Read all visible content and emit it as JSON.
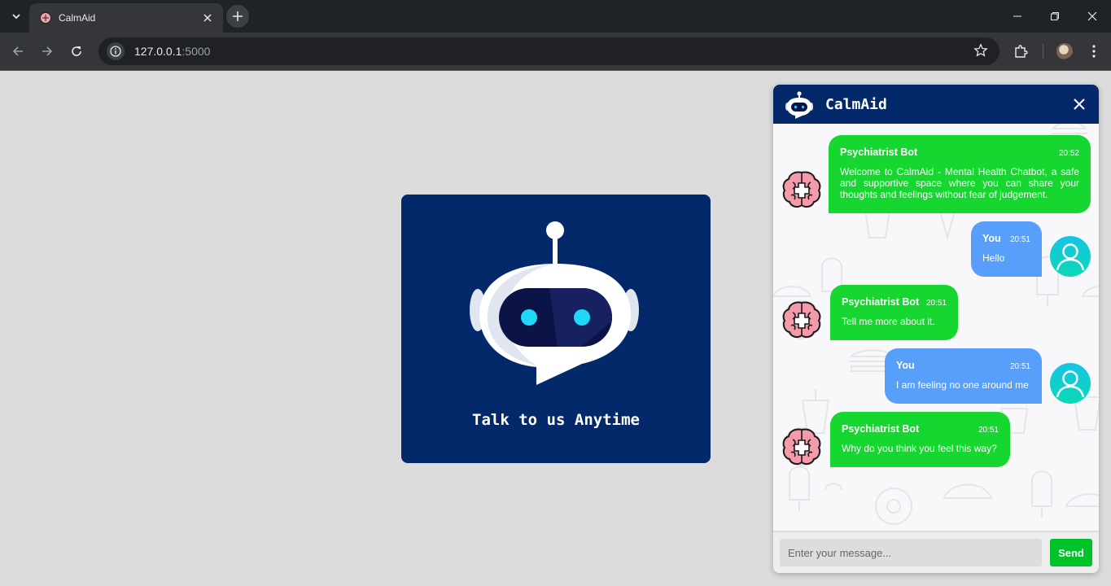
{
  "browser": {
    "tab_title": "CalmAid",
    "url_host": "127.0.0.1",
    "url_port": ":5000"
  },
  "hero": {
    "tagline": "Talk to us Anytime"
  },
  "chat": {
    "title": "CalmAid",
    "messages": [
      {
        "sender": "Psychiatrist Bot",
        "time": "20:52",
        "text": "Welcome to CalmAid - Mental Health Chatbot, a safe and supportive space where you can share your thoughts and feelings without fear of judgement.",
        "role": "bot"
      },
      {
        "sender": "You",
        "time": "20:51",
        "text": "Hello",
        "role": "user"
      },
      {
        "sender": "Psychiatrist Bot",
        "time": "20:51",
        "text": "Tell me more about it.",
        "role": "bot"
      },
      {
        "sender": "You",
        "time": "20:51",
        "text": "I am feeling no one around me",
        "role": "user"
      },
      {
        "sender": "Psychiatrist Bot",
        "time": "20:51",
        "text": "Why do you think you feel this way?",
        "role": "bot"
      }
    ],
    "input_placeholder": "Enter your message...",
    "send_label": "Send"
  },
  "colors": {
    "navy": "#03296b",
    "bot_bubble": "#16d72f",
    "user_bubble": "#579ffb",
    "send_button": "#00c22b"
  }
}
